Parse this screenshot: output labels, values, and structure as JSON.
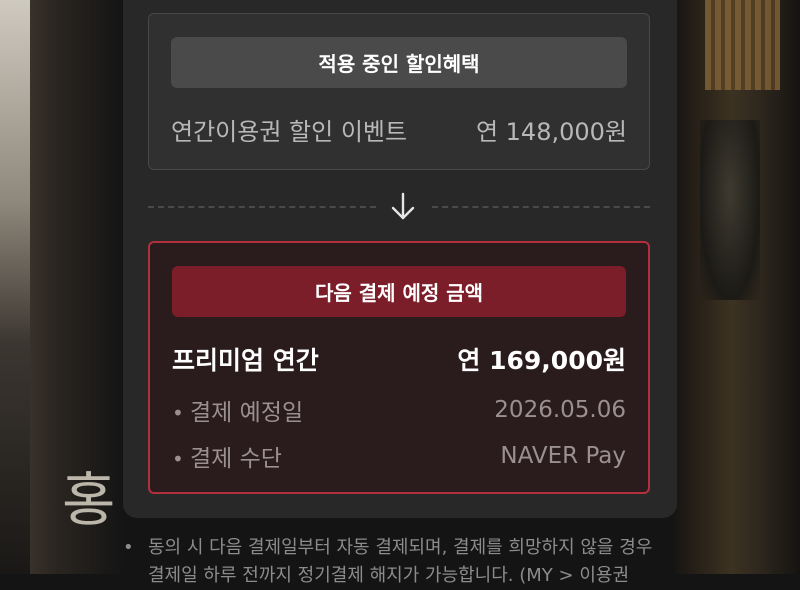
{
  "discount": {
    "header": "적용 중인 할인혜택",
    "event_label": "연간이용권 할인 이벤트",
    "event_amount": "연 148,000원"
  },
  "next_payment": {
    "header": "다음 결제 예정 금액",
    "plan_name": "프리미엄 연간",
    "plan_amount": "연 169,000원",
    "details": [
      {
        "label": "결제 예정일",
        "value": "2026.05.06"
      },
      {
        "label": "결제 수단",
        "value": "NAVER Pay"
      }
    ]
  },
  "notice": {
    "bullet": "•",
    "line1": "동의 시 다음 결제일부터 자동 결제되며, 결제를 희망하지 않을 경우",
    "line2": "결제일 하루 전까지 정기결제 해지가 가능합니다. (MY > 이용권"
  },
  "icons": {
    "arrow": "arrow-down-icon"
  },
  "colors": {
    "accent": "#b2303e",
    "header_red": "#7c1e2a",
    "panel": "#282828"
  }
}
